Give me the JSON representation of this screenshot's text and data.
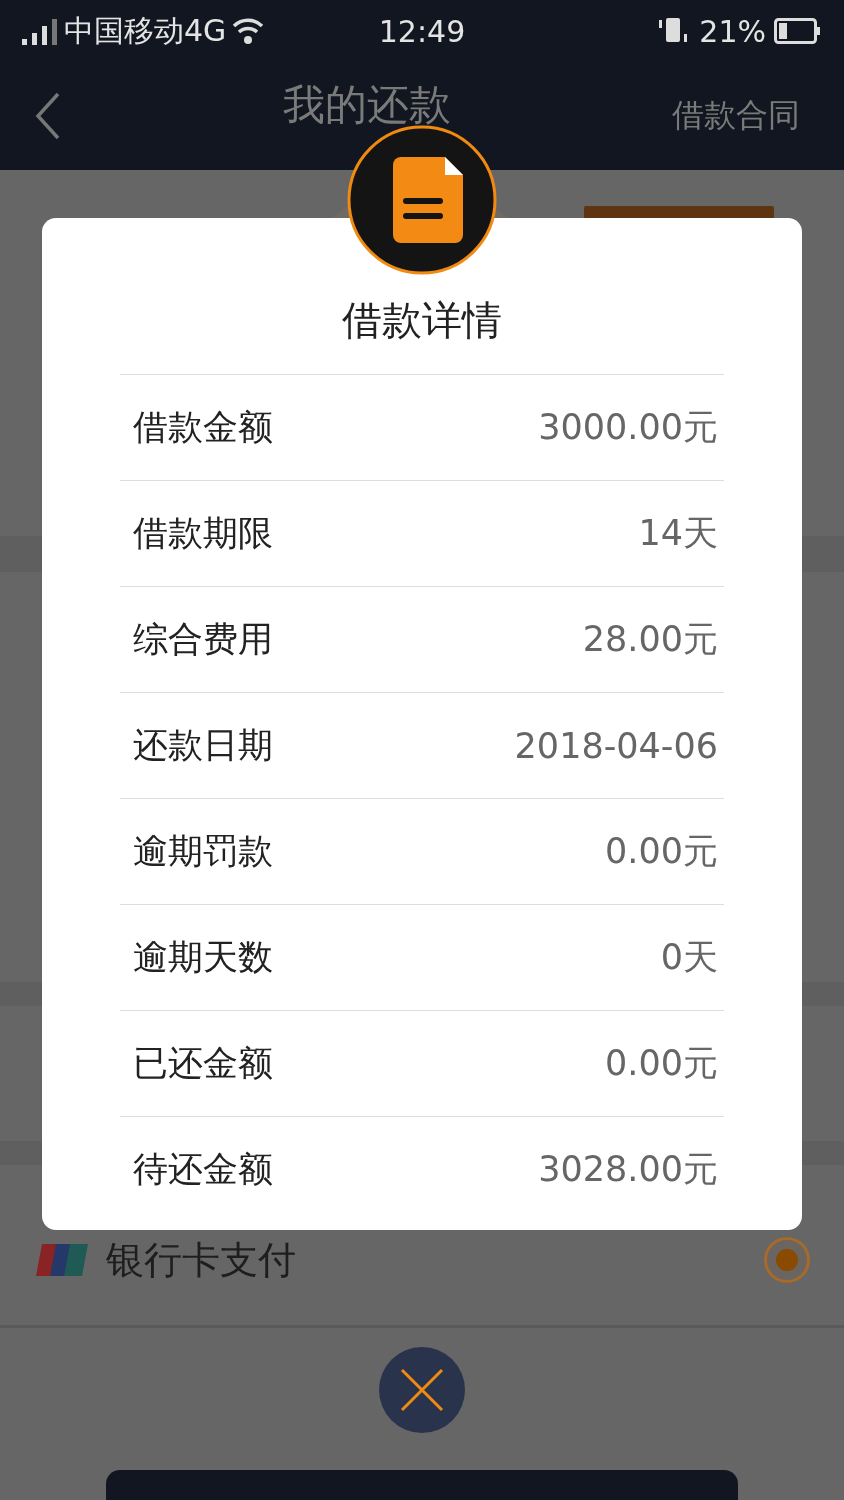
{
  "status_bar": {
    "carrier": "中国移动4G",
    "time": "12:49",
    "battery": "21%"
  },
  "nav": {
    "title": "我的还款",
    "action": "借款合同"
  },
  "payment_option": {
    "label": "银行卡支付",
    "selected": true
  },
  "dialog": {
    "title": "借款详情",
    "rows": [
      {
        "label": "借款金额",
        "value": "3000.00元"
      },
      {
        "label": "借款期限",
        "value": "14天"
      },
      {
        "label": "综合费用",
        "value": "28.00元"
      },
      {
        "label": "还款日期",
        "value": "2018-04-06"
      },
      {
        "label": "逾期罚款",
        "value": "0.00元"
      },
      {
        "label": "逾期天数",
        "value": "0天"
      },
      {
        "label": "已还金额",
        "value": "0.00元"
      },
      {
        "label": "待还金额",
        "value": "3028.00元"
      }
    ]
  }
}
